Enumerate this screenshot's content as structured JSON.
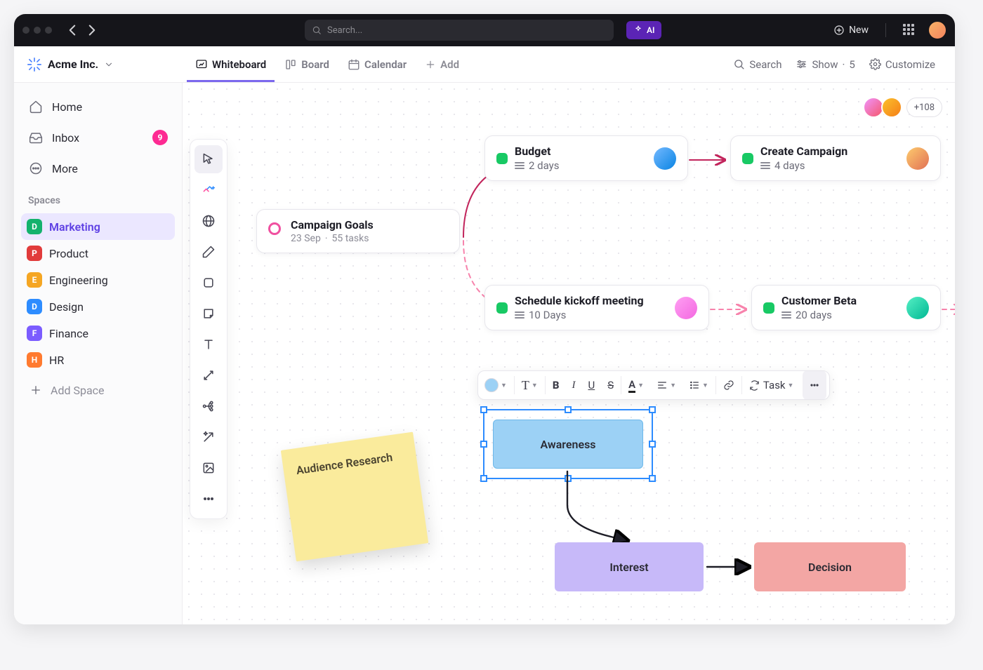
{
  "topbar": {
    "search_placeholder": "Search...",
    "ai_label": "AI",
    "new_label": "New"
  },
  "workspace": {
    "name": "Acme Inc."
  },
  "views": [
    {
      "label": "Whiteboard",
      "active": true
    },
    {
      "label": "Board",
      "active": false
    },
    {
      "label": "Calendar",
      "active": false
    }
  ],
  "view_add_label": "Add",
  "controls": {
    "search": "Search",
    "show": "Show",
    "show_count": "5",
    "customize": "Customize"
  },
  "nav": {
    "home": "Home",
    "inbox": "Inbox",
    "inbox_badge": "9",
    "more": "More"
  },
  "spaces_label": "Spaces",
  "spaces": [
    {
      "letter": "D",
      "label": "Marketing",
      "color": "#14b26d",
      "active": true
    },
    {
      "letter": "P",
      "label": "Product",
      "color": "#e13b3b",
      "active": false
    },
    {
      "letter": "E",
      "label": "Engineering",
      "color": "#f5a623",
      "active": false
    },
    {
      "letter": "D",
      "label": "Design",
      "color": "#2d8cff",
      "active": false
    },
    {
      "letter": "F",
      "label": "Finance",
      "color": "#7b5cff",
      "active": false
    },
    {
      "letter": "H",
      "label": "HR",
      "color": "#ff7a2f",
      "active": false
    }
  ],
  "add_space_label": "Add Space",
  "presence": {
    "overflow": "+108"
  },
  "goal_card": {
    "title": "Campaign Goals",
    "date": "23 Sep",
    "tasks": "55 tasks"
  },
  "tasks": {
    "budget": {
      "title": "Budget",
      "days": "2 days"
    },
    "create": {
      "title": "Create Campaign",
      "days": "4 days"
    },
    "kickoff": {
      "title": "Schedule kickoff meeting",
      "days": "10 Days"
    },
    "beta": {
      "title": "Customer Beta",
      "days": "20 days"
    }
  },
  "sticky": {
    "text": "Audience Research"
  },
  "flow": {
    "awareness": "Awareness",
    "interest": "Interest",
    "decision": "Decision"
  },
  "toolbar": {
    "task": "Task"
  }
}
